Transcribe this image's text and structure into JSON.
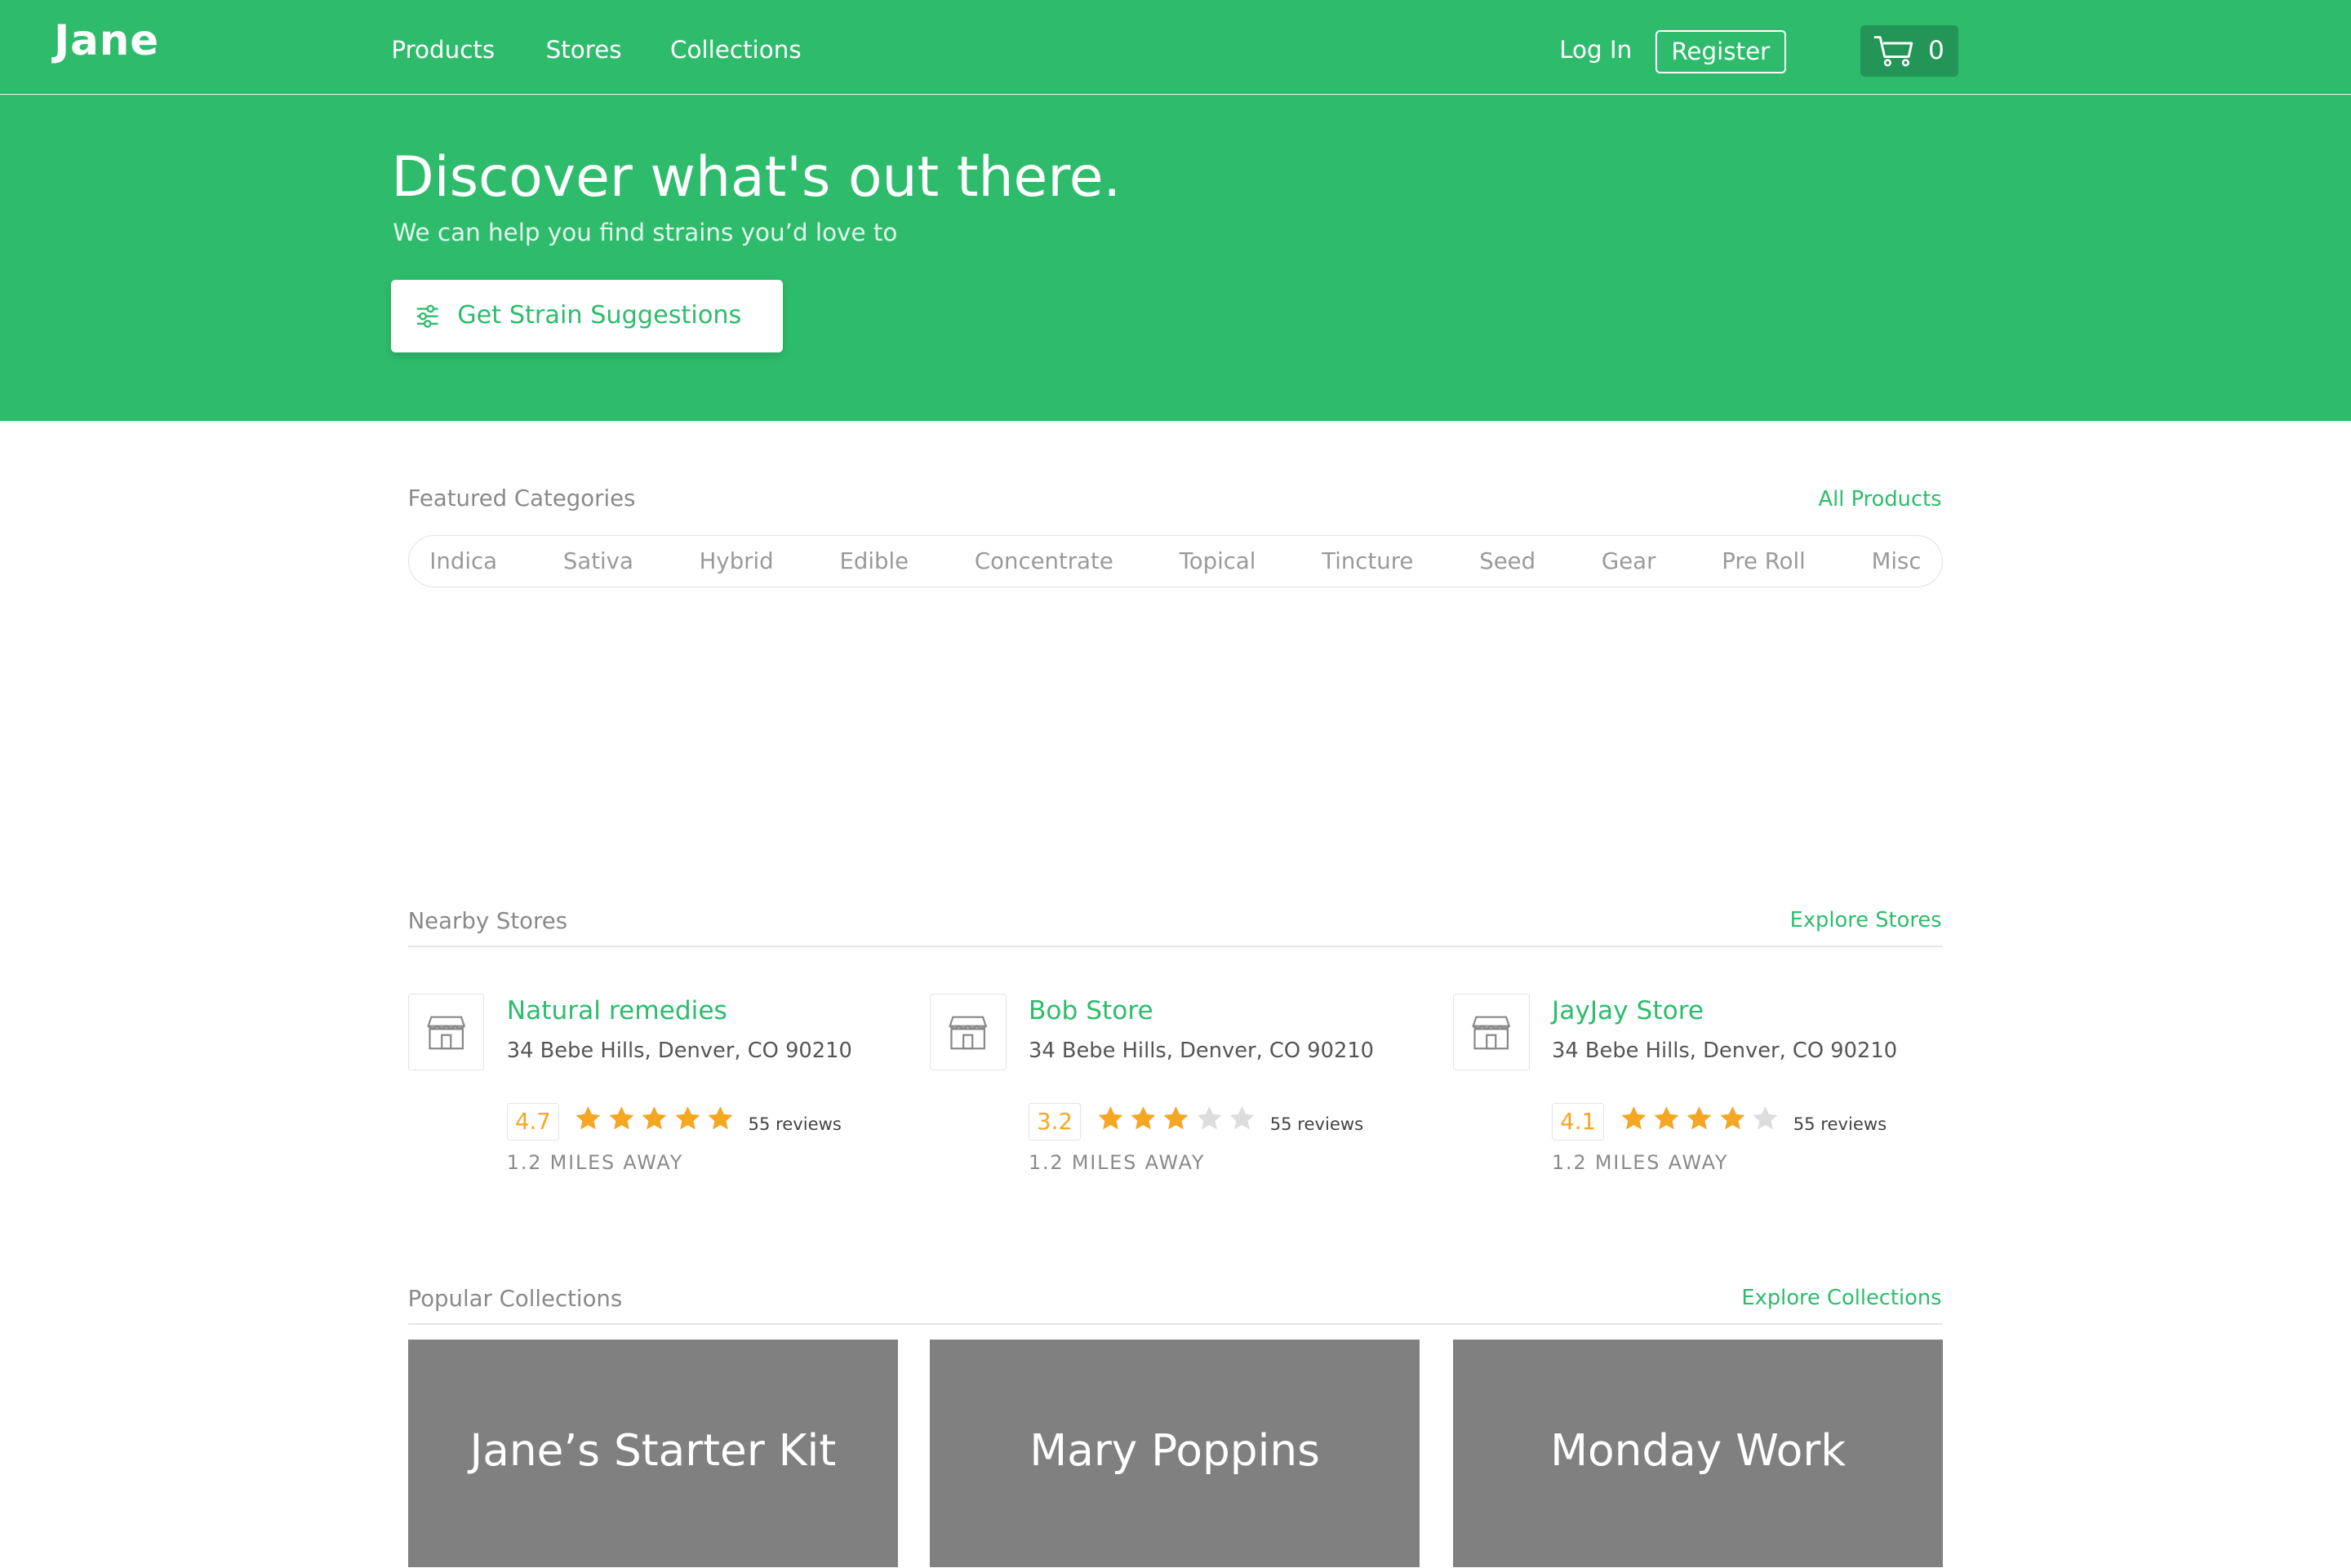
{
  "header": {
    "logo": "Jane",
    "nav": [
      {
        "label": "Products"
      },
      {
        "label": "Stores"
      },
      {
        "label": "Collections"
      }
    ],
    "login_label": "Log In",
    "register_label": "Register",
    "cart_count": "0",
    "cart_icon": "cart-icon"
  },
  "hero": {
    "title": "Discover what's out there.",
    "subtitle": "We can help you find strains you’d love to",
    "button_label": "Get Strain Suggestions",
    "button_icon": "sliders-icon"
  },
  "featured_categories": {
    "title": "Featured Categories",
    "link": "All Products",
    "items": [
      "Indica",
      "Sativa",
      "Hybrid",
      "Edible",
      "Concentrate",
      "Topical",
      "Tincture",
      "Seed",
      "Gear",
      "Pre Roll",
      "Misc"
    ]
  },
  "nearby_stores": {
    "title": "Nearby Stores",
    "link": "Explore Stores",
    "stores": [
      {
        "name": "Natural remedies",
        "address": "34 Bebe Hills, Denver, CO 90210",
        "rating": "4.7",
        "stars": 5,
        "reviews": "55 reviews",
        "distance": "1.2 MILES AWAY"
      },
      {
        "name": "Bob Store",
        "address": "34 Bebe Hills, Denver, CO 90210",
        "rating": "3.2",
        "stars": 3,
        "reviews": "55 reviews",
        "distance": "1.2 MILES AWAY"
      },
      {
        "name": "JayJay Store",
        "address": "34 Bebe Hills, Denver, CO 90210",
        "rating": "4.1",
        "stars": 4,
        "reviews": "55 reviews",
        "distance": "1.2 MILES AWAY"
      }
    ]
  },
  "popular_collections": {
    "title": "Popular Collections",
    "link": "Explore Collections",
    "items": [
      {
        "title": "Jane’s Starter Kit"
      },
      {
        "title": "Mary Poppins"
      },
      {
        "title": "Monday Work"
      }
    ]
  },
  "colors": {
    "brand_green": "#2ebc6c",
    "star_filled": "#f5a623",
    "star_empty": "#dddddd",
    "collection_bg": "#808080"
  }
}
